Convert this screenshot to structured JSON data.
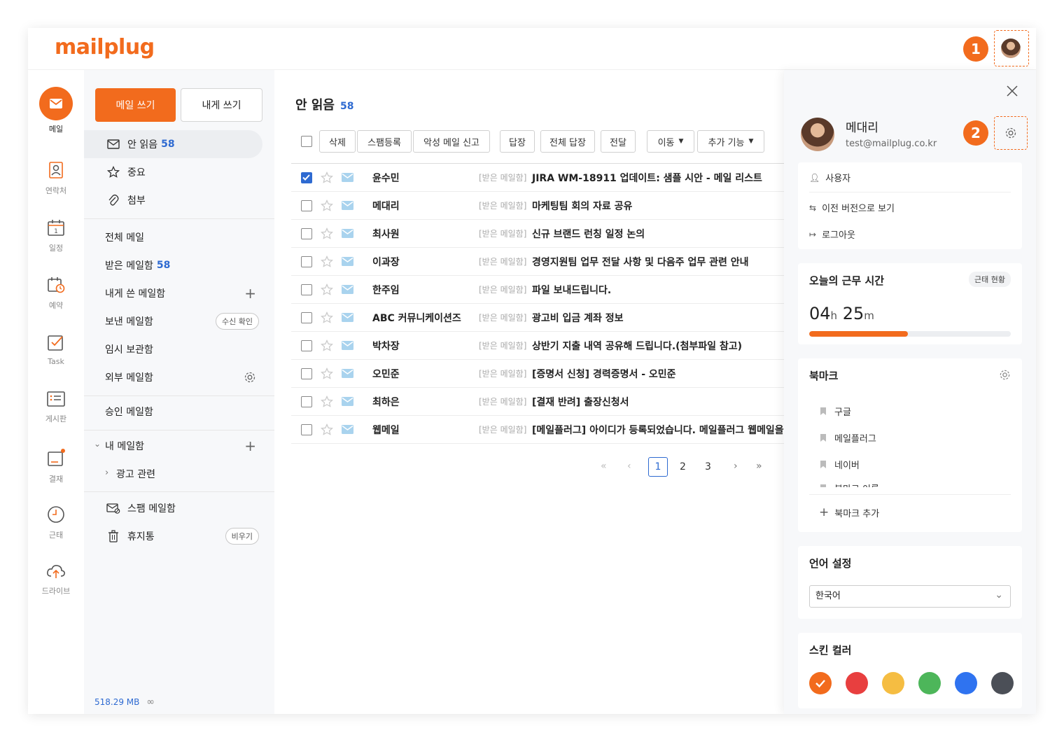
{
  "brand": {
    "logo": "mailplug",
    "accent": "#f26b1d"
  },
  "callouts": [
    "1",
    "2"
  ],
  "nav": [
    {
      "label": "메일"
    },
    {
      "label": "연락처"
    },
    {
      "label": "일정"
    },
    {
      "label": "예약"
    },
    {
      "label": "Task"
    },
    {
      "label": "게시판"
    },
    {
      "label": "결재"
    },
    {
      "label": "근태"
    },
    {
      "label": "드라이브"
    }
  ],
  "folders": {
    "compose": "메일 쓰기",
    "self_compose": "내게 쓰기",
    "unread": {
      "label": "안 읽음",
      "count": "58"
    },
    "starred": "중요",
    "attach": "첨부",
    "all": "전체 메일",
    "inbox": {
      "label": "받은 메일함",
      "count": "58"
    },
    "self_box": "내게 쓴 메일함",
    "sent": "보낸 메일함",
    "receipt": "수신 확인",
    "drafts": "임시 보관함",
    "external": "외부 메일함",
    "approval": "승인 메일함",
    "my_box": "내 메일함",
    "ad": "광고 관련",
    "spam": "스팸 메일함",
    "trash": "휴지통",
    "empty": "비우기",
    "storage": "518.29 MB",
    "storage_limit": "∞"
  },
  "main": {
    "title": "안 읽음",
    "count": "58",
    "toolbar": [
      "삭제",
      "스팸등록",
      "악성 메일 신고",
      "답장",
      "전체 답장",
      "전달",
      "이동",
      "추가 기능"
    ],
    "rows": [
      {
        "sender": "윤수민",
        "tag": "[받은 메일함]",
        "subject": "JIRA WM-18911 업데이트: 샘플 시안 - 메일 리스트",
        "checked": true
      },
      {
        "sender": "메대리",
        "tag": "[받은 메일함]",
        "subject": "마케팅팀 회의 자료 공유",
        "checked": false
      },
      {
        "sender": "최사원",
        "tag": "[받은 메일함]",
        "subject": "신규 브랜드 런칭 일정 논의",
        "checked": false
      },
      {
        "sender": "이과장",
        "tag": "[받은 메일함]",
        "subject": "경영지원팀 업무 전달 사항 및 다음주 업무 관련 안내",
        "checked": false
      },
      {
        "sender": "한주임",
        "tag": "[받은 메일함]",
        "subject": "파일 보내드립니다.",
        "checked": false
      },
      {
        "sender": "ABC 커뮤니케이션즈",
        "tag": "[받은 메일함]",
        "subject": "광고비 입금 계좌 정보",
        "checked": false
      },
      {
        "sender": "박차장",
        "tag": "[받은 메일함]",
        "subject": "상반기 지출 내역 공유해 드립니다.(첨부파일 참고)",
        "checked": false
      },
      {
        "sender": "오민준",
        "tag": "[받은 메일함]",
        "subject": "[증명서 신청] 경력증명서 - 오민준",
        "checked": false
      },
      {
        "sender": "최하은",
        "tag": "[받은 메일함]",
        "subject": "[결재 반려] 출장신청서",
        "checked": false
      },
      {
        "sender": "웹메일",
        "tag": "[받은 메일함]",
        "subject": "[메일플러그] 아이디가 등록되었습니다. 메일플러그 웹메일을 사",
        "checked": false
      }
    ],
    "pages": [
      "1",
      "2",
      "3"
    ],
    "current_page": "1"
  },
  "profile": {
    "name": "메대리",
    "email": "test@mailplug.co.kr",
    "menu": [
      "사용자",
      "이전 버전으로 보기",
      "로그아웃"
    ]
  },
  "work": {
    "title": "오늘의 근무 시간",
    "status_button": "근태 현황",
    "hours": "04",
    "h": "h",
    "minutes": "25",
    "m": "m",
    "progress": 0.49
  },
  "bookmarks": {
    "title": "북마크",
    "items": [
      "구글",
      "메일플러그",
      "네이버",
      "북마크 이름"
    ],
    "add": "북마크 추가"
  },
  "language": {
    "title": "언어 설정",
    "value": "한국어"
  },
  "skin": {
    "title": "스킨 컬러",
    "colors": [
      "#f26b1d",
      "#e83f3f",
      "#f5bd42",
      "#4db65a",
      "#2f73f0",
      "#4b4f57"
    ],
    "selected": 0
  }
}
